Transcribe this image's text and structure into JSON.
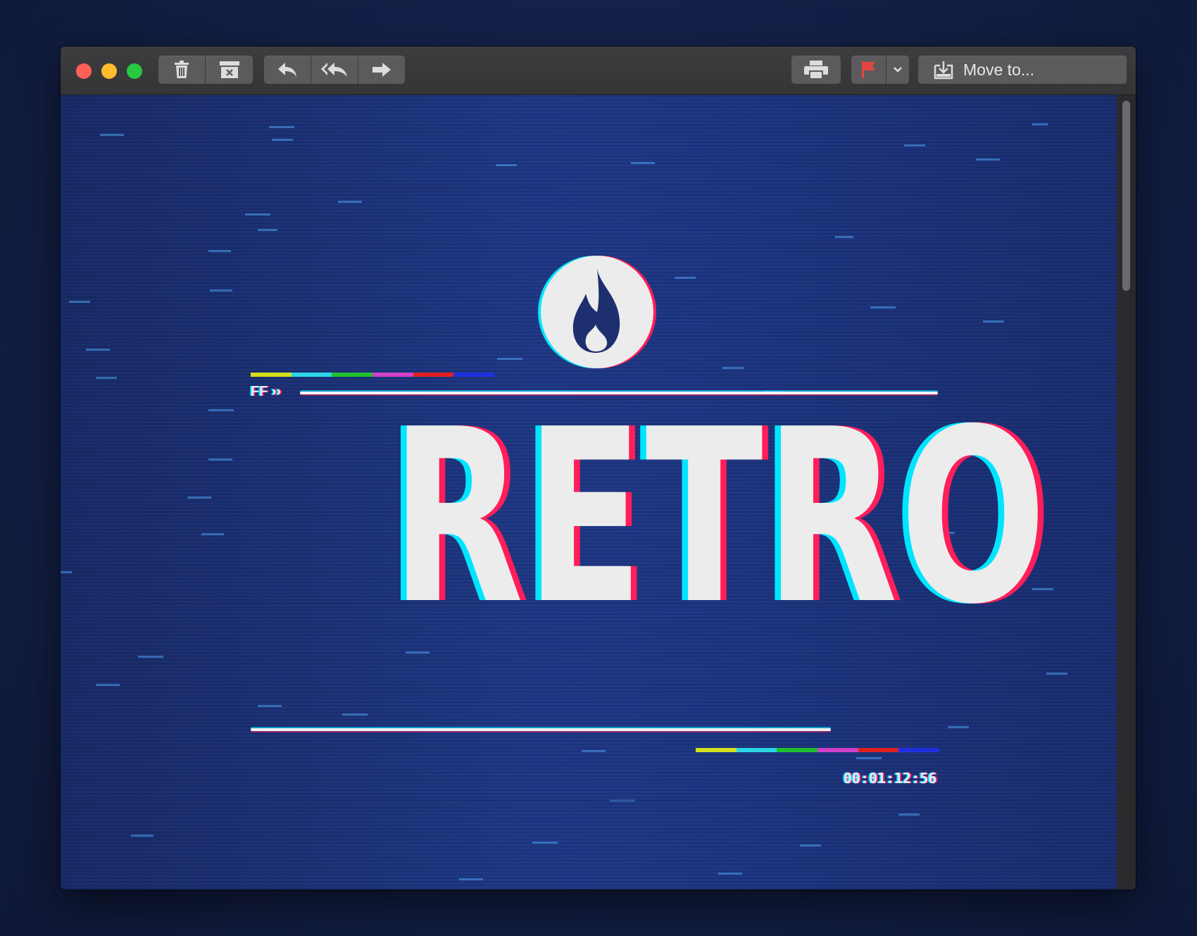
{
  "window": {
    "traffic_lights": {
      "close": "#fe5f57",
      "minimize": "#febc2e",
      "maximize": "#28c840"
    }
  },
  "toolbar": {
    "group1": [
      {
        "icon": "trash-icon"
      },
      {
        "icon": "archive-icon"
      }
    ],
    "group2": [
      {
        "icon": "reply-icon"
      },
      {
        "icon": "reply-all-icon"
      },
      {
        "icon": "forward-icon"
      }
    ],
    "print_icon": "printer-icon",
    "flag_icon": "flag-icon",
    "flag_color": "#e2463f",
    "flag_menu_icon": "chevron-down-icon",
    "move_icon": "move-to-mailbox-icon",
    "move_label": "Move to..."
  },
  "email_content": {
    "logo_icon": "flame-icon",
    "ff_label": "FF ››",
    "title": "RETRO",
    "timecode": "00:01:12:56",
    "glitch_colors": [
      "#d4e01a",
      "#2bd6e6",
      "#20c030",
      "#d040c8",
      "#e02020",
      "#2030e0"
    ]
  }
}
